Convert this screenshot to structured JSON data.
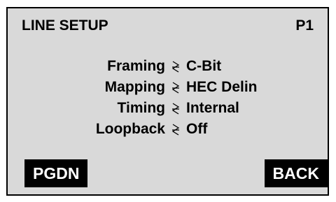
{
  "screen": {
    "title": "LINE SETUP",
    "page_id": "P1"
  },
  "settings": [
    {
      "label": "Framing",
      "value": "C-Bit",
      "separator_icon": "lightning-separator-icon"
    },
    {
      "label": "Mapping",
      "value": "HEC Delin",
      "separator_icon": "lightning-separator-icon"
    },
    {
      "label": "Timing",
      "value": "Internal",
      "separator_icon": "lightning-separator-icon"
    },
    {
      "label": "Loopback",
      "value": "Off",
      "separator_icon": "lightning-separator-icon"
    }
  ],
  "softkeys": {
    "left_label": "PGDN",
    "right_label": "BACK"
  },
  "colors": {
    "screen_background": "#d9d9d9",
    "border": "#000000",
    "text": "#000000",
    "softkey_background": "#000000",
    "softkey_text": "#ffffff"
  }
}
